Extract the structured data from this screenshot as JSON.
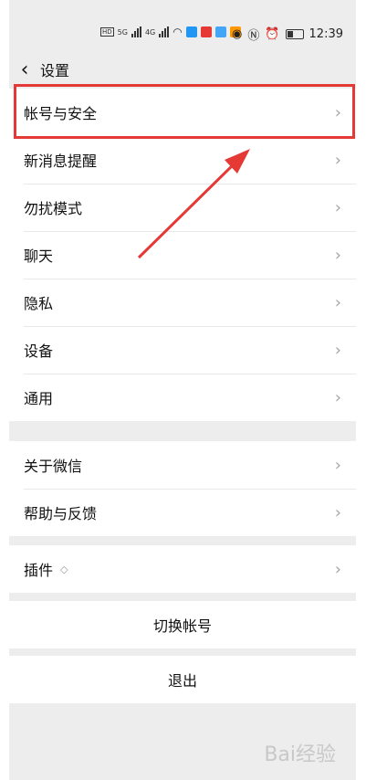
{
  "status_bar": {
    "time": "12:39",
    "network_labels": [
      "5G",
      "4G"
    ]
  },
  "header": {
    "back_glyph": "‹",
    "title": "设置"
  },
  "groups": [
    {
      "items": [
        {
          "label": "帐号与安全"
        },
        {
          "label": "新消息提醒"
        },
        {
          "label": "勿扰模式"
        },
        {
          "label": "聊天"
        },
        {
          "label": "隐私"
        },
        {
          "label": "设备"
        },
        {
          "label": "通用"
        }
      ]
    },
    {
      "items": [
        {
          "label": "关于微信"
        },
        {
          "label": "帮助与反馈"
        }
      ]
    },
    {
      "items": [
        {
          "label": "插件"
        }
      ]
    }
  ],
  "actions": {
    "switch_account": "切换帐号",
    "logout": "退出"
  },
  "chevron": "›",
  "annotation": {
    "highlight_color": "#e53935"
  },
  "watermark": "Bai经验"
}
